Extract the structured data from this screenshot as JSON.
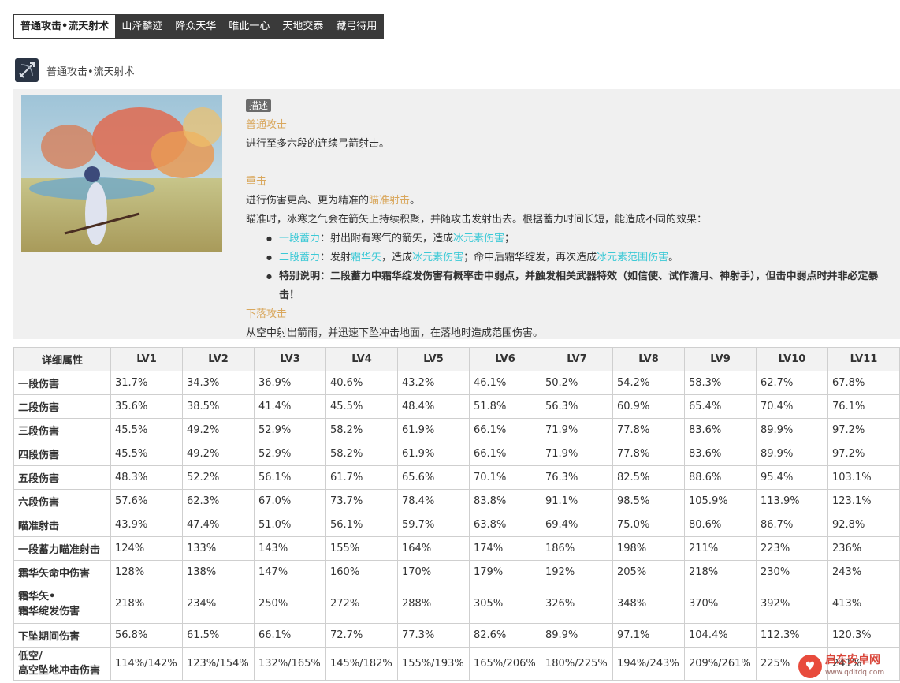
{
  "tabs": [
    {
      "label": "普通攻击•流天射术",
      "active": true
    },
    {
      "label": "山泽麟迹",
      "active": false
    },
    {
      "label": "降众天华",
      "active": false
    },
    {
      "label": "唯此一心",
      "active": false
    },
    {
      "label": "天地交泰",
      "active": false
    },
    {
      "label": "藏弓待用",
      "active": false
    }
  ],
  "skill": {
    "name": "普通攻击•流天射术",
    "icon": "bow-arrow-icon"
  },
  "description": {
    "badge": "描述",
    "normal_title": "普通攻击",
    "normal_text": "进行至多六段的连续弓箭射击。",
    "charged_title": "重击",
    "charged_text_1a": "进行伤害更高、更为精准的",
    "charged_text_1b": "瞄准射击",
    "charged_text_1c": "。",
    "charged_text_2": "瞄准时，冰寒之气会在箭矢上持续积聚，并随攻击发射出去。根据蓄力时间长短，能造成不同的效果：",
    "bullet1": {
      "a": "一段蓄力",
      "b": "：射出附有寒气的箭矢，造成",
      "c": "冰元素伤害",
      "d": "；"
    },
    "bullet2": {
      "a": "二段蓄力",
      "b": "：发射",
      "c": "霜华矢",
      "d": "，造成",
      "e": "冰元素伤害",
      "f": "；命中后霜华绽发，再次造成",
      "g": "冰元素范围伤害",
      "h": "。"
    },
    "bullet3": "特别说明：二段蓄力中霜华绽发伤害有概率击中弱点，并触发相关武器特效（如信使、试作澹月、神射手），但击中弱点时并非必定暴击！",
    "plunge_title": "下落攻击",
    "plunge_text": "从空中射出箭雨，并迅速下坠冲击地面，在落地时造成范围伤害。"
  },
  "table": {
    "headers": [
      "详细属性",
      "LV1",
      "LV2",
      "LV3",
      "LV4",
      "LV5",
      "LV6",
      "LV7",
      "LV8",
      "LV9",
      "LV10",
      "LV11"
    ],
    "rows": [
      {
        "name": "一段伤害",
        "values": [
          "31.7%",
          "34.3%",
          "36.9%",
          "40.6%",
          "43.2%",
          "46.1%",
          "50.2%",
          "54.2%",
          "58.3%",
          "62.7%",
          "67.8%"
        ]
      },
      {
        "name": "二段伤害",
        "values": [
          "35.6%",
          "38.5%",
          "41.4%",
          "45.5%",
          "48.4%",
          "51.8%",
          "56.3%",
          "60.9%",
          "65.4%",
          "70.4%",
          "76.1%"
        ]
      },
      {
        "name": "三段伤害",
        "values": [
          "45.5%",
          "49.2%",
          "52.9%",
          "58.2%",
          "61.9%",
          "66.1%",
          "71.9%",
          "77.8%",
          "83.6%",
          "89.9%",
          "97.2%"
        ]
      },
      {
        "name": "四段伤害",
        "values": [
          "45.5%",
          "49.2%",
          "52.9%",
          "58.2%",
          "61.9%",
          "66.1%",
          "71.9%",
          "77.8%",
          "83.6%",
          "89.9%",
          "97.2%"
        ]
      },
      {
        "name": "五段伤害",
        "values": [
          "48.3%",
          "52.2%",
          "56.1%",
          "61.7%",
          "65.6%",
          "70.1%",
          "76.3%",
          "82.5%",
          "88.6%",
          "95.4%",
          "103.1%"
        ]
      },
      {
        "name": "六段伤害",
        "values": [
          "57.6%",
          "62.3%",
          "67.0%",
          "73.7%",
          "78.4%",
          "83.8%",
          "91.1%",
          "98.5%",
          "105.9%",
          "113.9%",
          "123.1%"
        ]
      },
      {
        "name": "瞄准射击",
        "values": [
          "43.9%",
          "47.4%",
          "51.0%",
          "56.1%",
          "59.7%",
          "63.8%",
          "69.4%",
          "75.0%",
          "80.6%",
          "86.7%",
          "92.8%"
        ]
      },
      {
        "name": "一段蓄力瞄准射击",
        "values": [
          "124%",
          "133%",
          "143%",
          "155%",
          "164%",
          "174%",
          "186%",
          "198%",
          "211%",
          "223%",
          "236%"
        ]
      },
      {
        "name": "霜华矢命中伤害",
        "values": [
          "128%",
          "138%",
          "147%",
          "160%",
          "170%",
          "179%",
          "192%",
          "205%",
          "218%",
          "230%",
          "243%"
        ]
      },
      {
        "name1": "霜华矢•",
        "name2": "霜华绽发伤害",
        "values": [
          "218%",
          "234%",
          "250%",
          "272%",
          "288%",
          "305%",
          "326%",
          "348%",
          "370%",
          "392%",
          "413%"
        ]
      },
      {
        "name": "下坠期间伤害",
        "values": [
          "56.8%",
          "61.5%",
          "66.1%",
          "72.7%",
          "77.3%",
          "82.6%",
          "89.9%",
          "97.1%",
          "104.4%",
          "112.3%",
          "120.3%"
        ]
      },
      {
        "name1": "低空/",
        "name2": "高空坠地冲击伤害",
        "values": [
          "114%/142%",
          "123%/154%",
          "132%/165%",
          "145%/182%",
          "155%/193%",
          "165%/206%",
          "180%/225%",
          "194%/243%",
          "209%/261%",
          "225%",
          "241%"
        ]
      }
    ]
  },
  "watermark": {
    "main": "启东安卓网",
    "sub": "www.qdltdq.com",
    "logo_icon": "heart-logo-icon"
  }
}
